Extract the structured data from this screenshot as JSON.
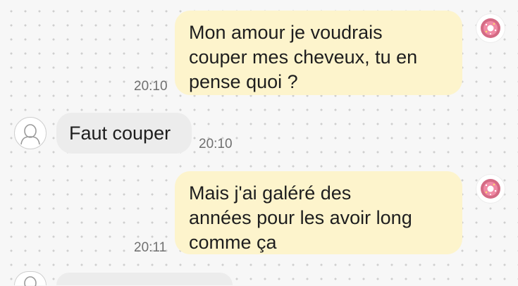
{
  "messages": [
    {
      "direction": "outgoing",
      "lines": [
        "Mon amour je voudrais",
        "couper mes cheveux, tu en",
        "pense quoi ?"
      ],
      "time": "20:10",
      "avatar_icon": "donut-avatar-icon"
    },
    {
      "direction": "incoming",
      "lines": [
        "Faut couper"
      ],
      "time": "20:10",
      "avatar_icon": "user-silhouette-icon"
    },
    {
      "direction": "outgoing",
      "lines": [
        "Mais j'ai galéré des",
        "années pour les avoir long",
        "comme ça"
      ],
      "time": "20:11",
      "avatar_icon": "donut-avatar-icon"
    },
    {
      "direction": "incoming",
      "lines": [],
      "time": "",
      "avatar_icon": "user-silhouette-icon"
    }
  ],
  "colors": {
    "outgoing_bubble": "#fdf4cc",
    "incoming_bubble": "#ececec",
    "background": "#f7f7f7",
    "timestamp": "#707070"
  }
}
